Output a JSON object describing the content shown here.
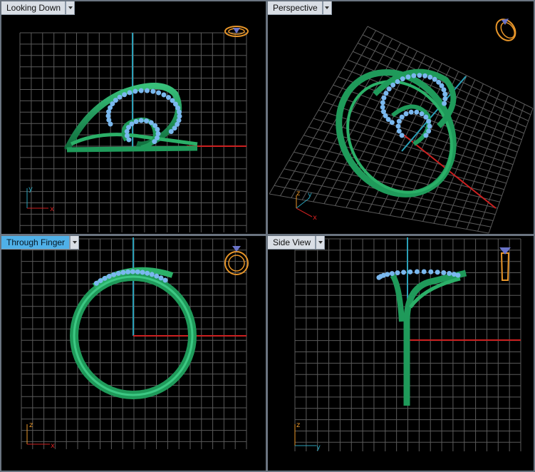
{
  "viewports": [
    {
      "title": "Looking Down",
      "active": false,
      "axes": [
        "y",
        "x"
      ]
    },
    {
      "title": "Perspective",
      "active": false,
      "axes": [
        "z",
        "y",
        "x"
      ]
    },
    {
      "title": "Through Finger",
      "active": true,
      "axes": [
        "z",
        "x"
      ]
    },
    {
      "title": "Side View",
      "active": false,
      "axes": [
        "z",
        "y"
      ]
    }
  ],
  "colors": {
    "background": "#000000",
    "grid": "#5a5a5a",
    "ring": "#1f9a5a",
    "stones": "#7ab8ee",
    "axis_x": "#cc2020",
    "axis_y": "#2aa0b8",
    "nav_icon": "#e8962a"
  },
  "icons": {
    "viewport_menu": "triangle-down-icon",
    "view_cube": "ring-view-icon"
  }
}
